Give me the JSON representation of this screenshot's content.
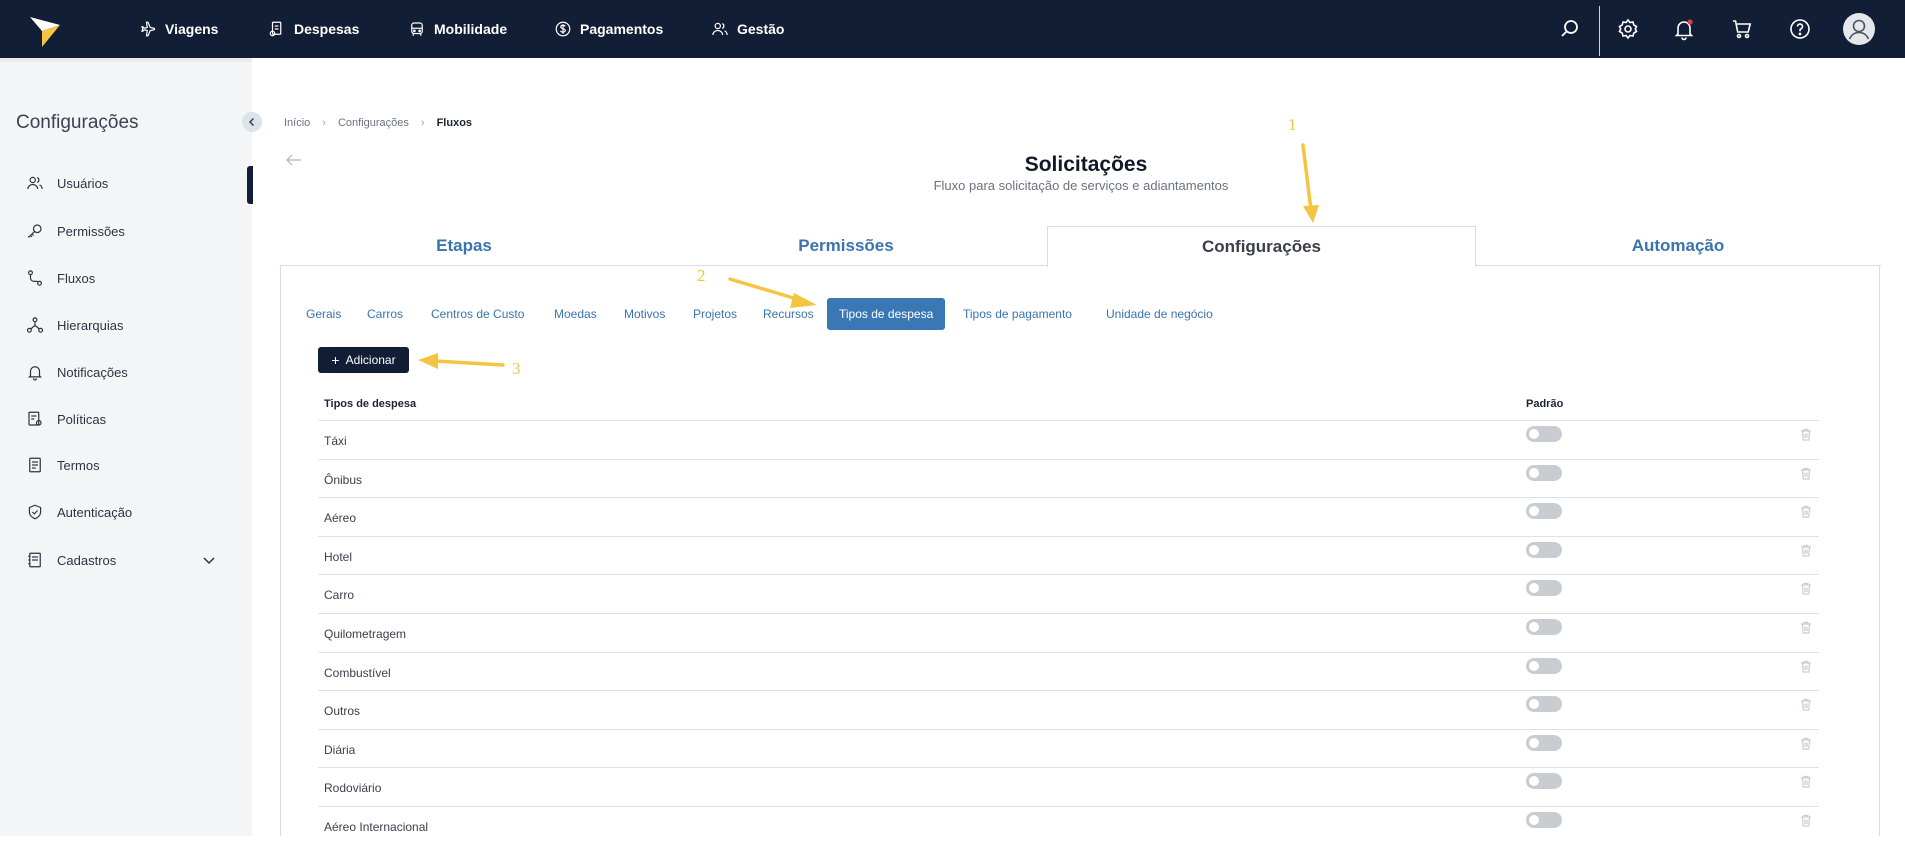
{
  "topnav": {
    "items": [
      {
        "label": "Viagens",
        "icon": "plane-icon"
      },
      {
        "label": "Despesas",
        "icon": "receipt-icon"
      },
      {
        "label": "Mobilidade",
        "icon": "car-icon"
      },
      {
        "label": "Pagamentos",
        "icon": "dollar-icon"
      },
      {
        "label": "Gestão",
        "icon": "users-icon"
      }
    ]
  },
  "sidebar": {
    "title": "Configurações",
    "items": [
      {
        "label": "Usuários"
      },
      {
        "label": "Permissões"
      },
      {
        "label": "Fluxos"
      },
      {
        "label": "Hierarquias"
      },
      {
        "label": "Notificações"
      },
      {
        "label": "Políticas"
      },
      {
        "label": "Termos"
      },
      {
        "label": "Autenticação"
      },
      {
        "label": "Cadastros"
      }
    ]
  },
  "breadcrumb": [
    "Início",
    "Configurações",
    "Fluxos"
  ],
  "page": {
    "title": "Solicitações",
    "subtitle": "Fluxo para solicitação de serviços e adiantamentos"
  },
  "tabs": [
    "Etapas",
    "Permissões",
    "Configurações",
    "Automação"
  ],
  "subtabs": [
    "Gerais",
    "Carros",
    "Centros de Custo",
    "Moedas",
    "Motivos",
    "Projetos",
    "Recursos",
    "Tipos de despesa",
    "Tipos de pagamento",
    "Unidade de negócio"
  ],
  "add_button": "Adicionar",
  "table": {
    "headers": [
      "Tipos de despesa",
      "Padrão"
    ],
    "rows": [
      "Táxi",
      "Ônibus",
      "Aéreo",
      "Hotel",
      "Carro",
      "Quilometragem",
      "Combustível",
      "Outros",
      "Diária",
      "Rodoviário",
      "Aéreo Internacional"
    ]
  },
  "annotations": [
    "1",
    "2",
    "3"
  ],
  "colors": {
    "topbar": "#121d36",
    "accent": "#3a78b5",
    "annotation": "#f5c542",
    "logo": "#f5c542"
  }
}
